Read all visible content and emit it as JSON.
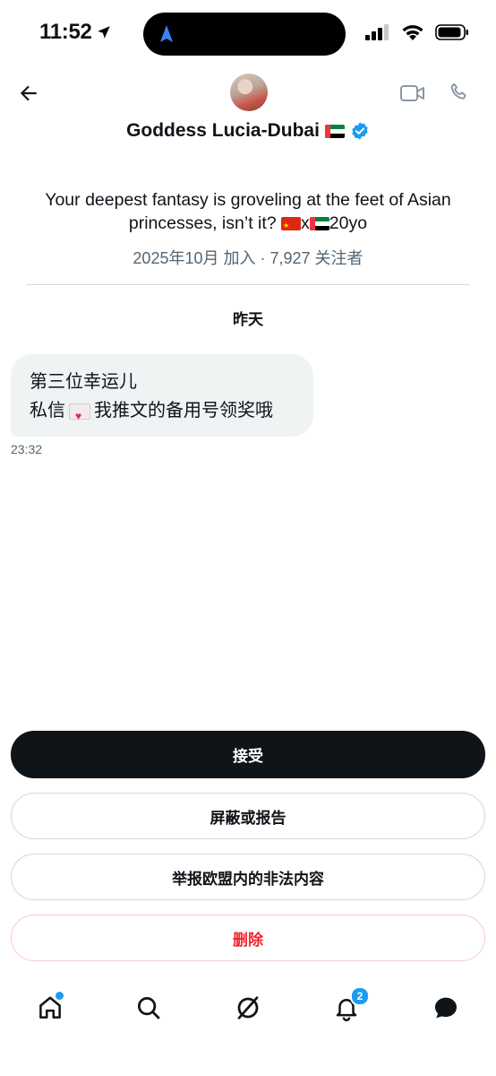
{
  "status_bar": {
    "time": "11:52",
    "icons": [
      "location-arrow-icon",
      "signal-icon",
      "wifi-icon",
      "battery-icon"
    ]
  },
  "header": {
    "back_icon": "arrow-left-icon",
    "display_name": "Goddess Lucia-Dubai",
    "verified": true,
    "bio_line1": "Your deepest fantasy is groveling at the feet of Asian",
    "bio_line2_prefix": "princesses, isn’t it?",
    "bio_line2_x": "x",
    "bio_line2_suffix": "20yo",
    "joined": "2025年10月 加入",
    "followers": "7,927 关注者",
    "actions": [
      "video-call-icon",
      "phone-call-icon"
    ]
  },
  "conversation": {
    "day_label": "昨天",
    "messages": [
      {
        "line1": "第三位幸运儿",
        "line2_prefix": "私信",
        "line2_suffix": "我推文的备用号领奖哦",
        "time": "23:32"
      }
    ]
  },
  "request_actions": {
    "accept": "接受",
    "block_or_report": "屏蔽或报告",
    "report_eu_illegal": "举报欧盟内的非法内容",
    "delete": "删除"
  },
  "tab_bar": {
    "items": [
      "home-icon",
      "search-icon",
      "grok-icon",
      "notifications-icon",
      "messages-icon"
    ],
    "notifications_badge": "2"
  },
  "colors": {
    "accent": "#1d9bf0",
    "text": "#0f1419",
    "muted": "#536471",
    "danger": "#f4212e"
  }
}
